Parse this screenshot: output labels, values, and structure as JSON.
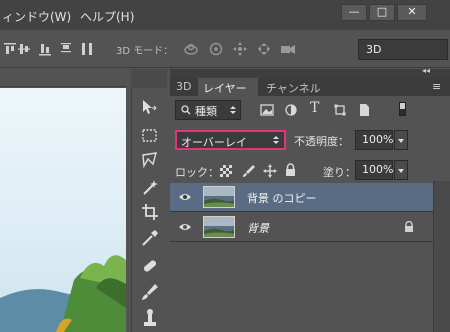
{
  "menu": {
    "items": [
      "ィンドウ(W)",
      "ヘルプ(H)"
    ],
    "window_controls": [
      "—",
      "□",
      "✕"
    ]
  },
  "options_bar": {
    "mode_label": "3D モード：",
    "workspace": "3D"
  },
  "panel": {
    "collapse_glyph": "◂◂",
    "tabs": [
      "3D",
      "レイヤー",
      "チャンネル"
    ],
    "menu_glyph": "≡",
    "filter": {
      "kind_label": "種類"
    },
    "blend_mode": "オーバーレイ",
    "opacity_label": "不透明度：",
    "opacity_value": "100%",
    "lock_label": "ロック：",
    "fill_label": "塗り：",
    "fill_value": "100%",
    "layers": [
      {
        "name": "背景 のコピー",
        "selected": true,
        "locked": false
      },
      {
        "name": "背景",
        "selected": false,
        "locked": true
      }
    ]
  },
  "colors": {
    "accent_highlight": "#e0357a",
    "selected_layer": "#5a6c83",
    "panel_bg": "#535353",
    "menubar_bg": "#434343"
  }
}
